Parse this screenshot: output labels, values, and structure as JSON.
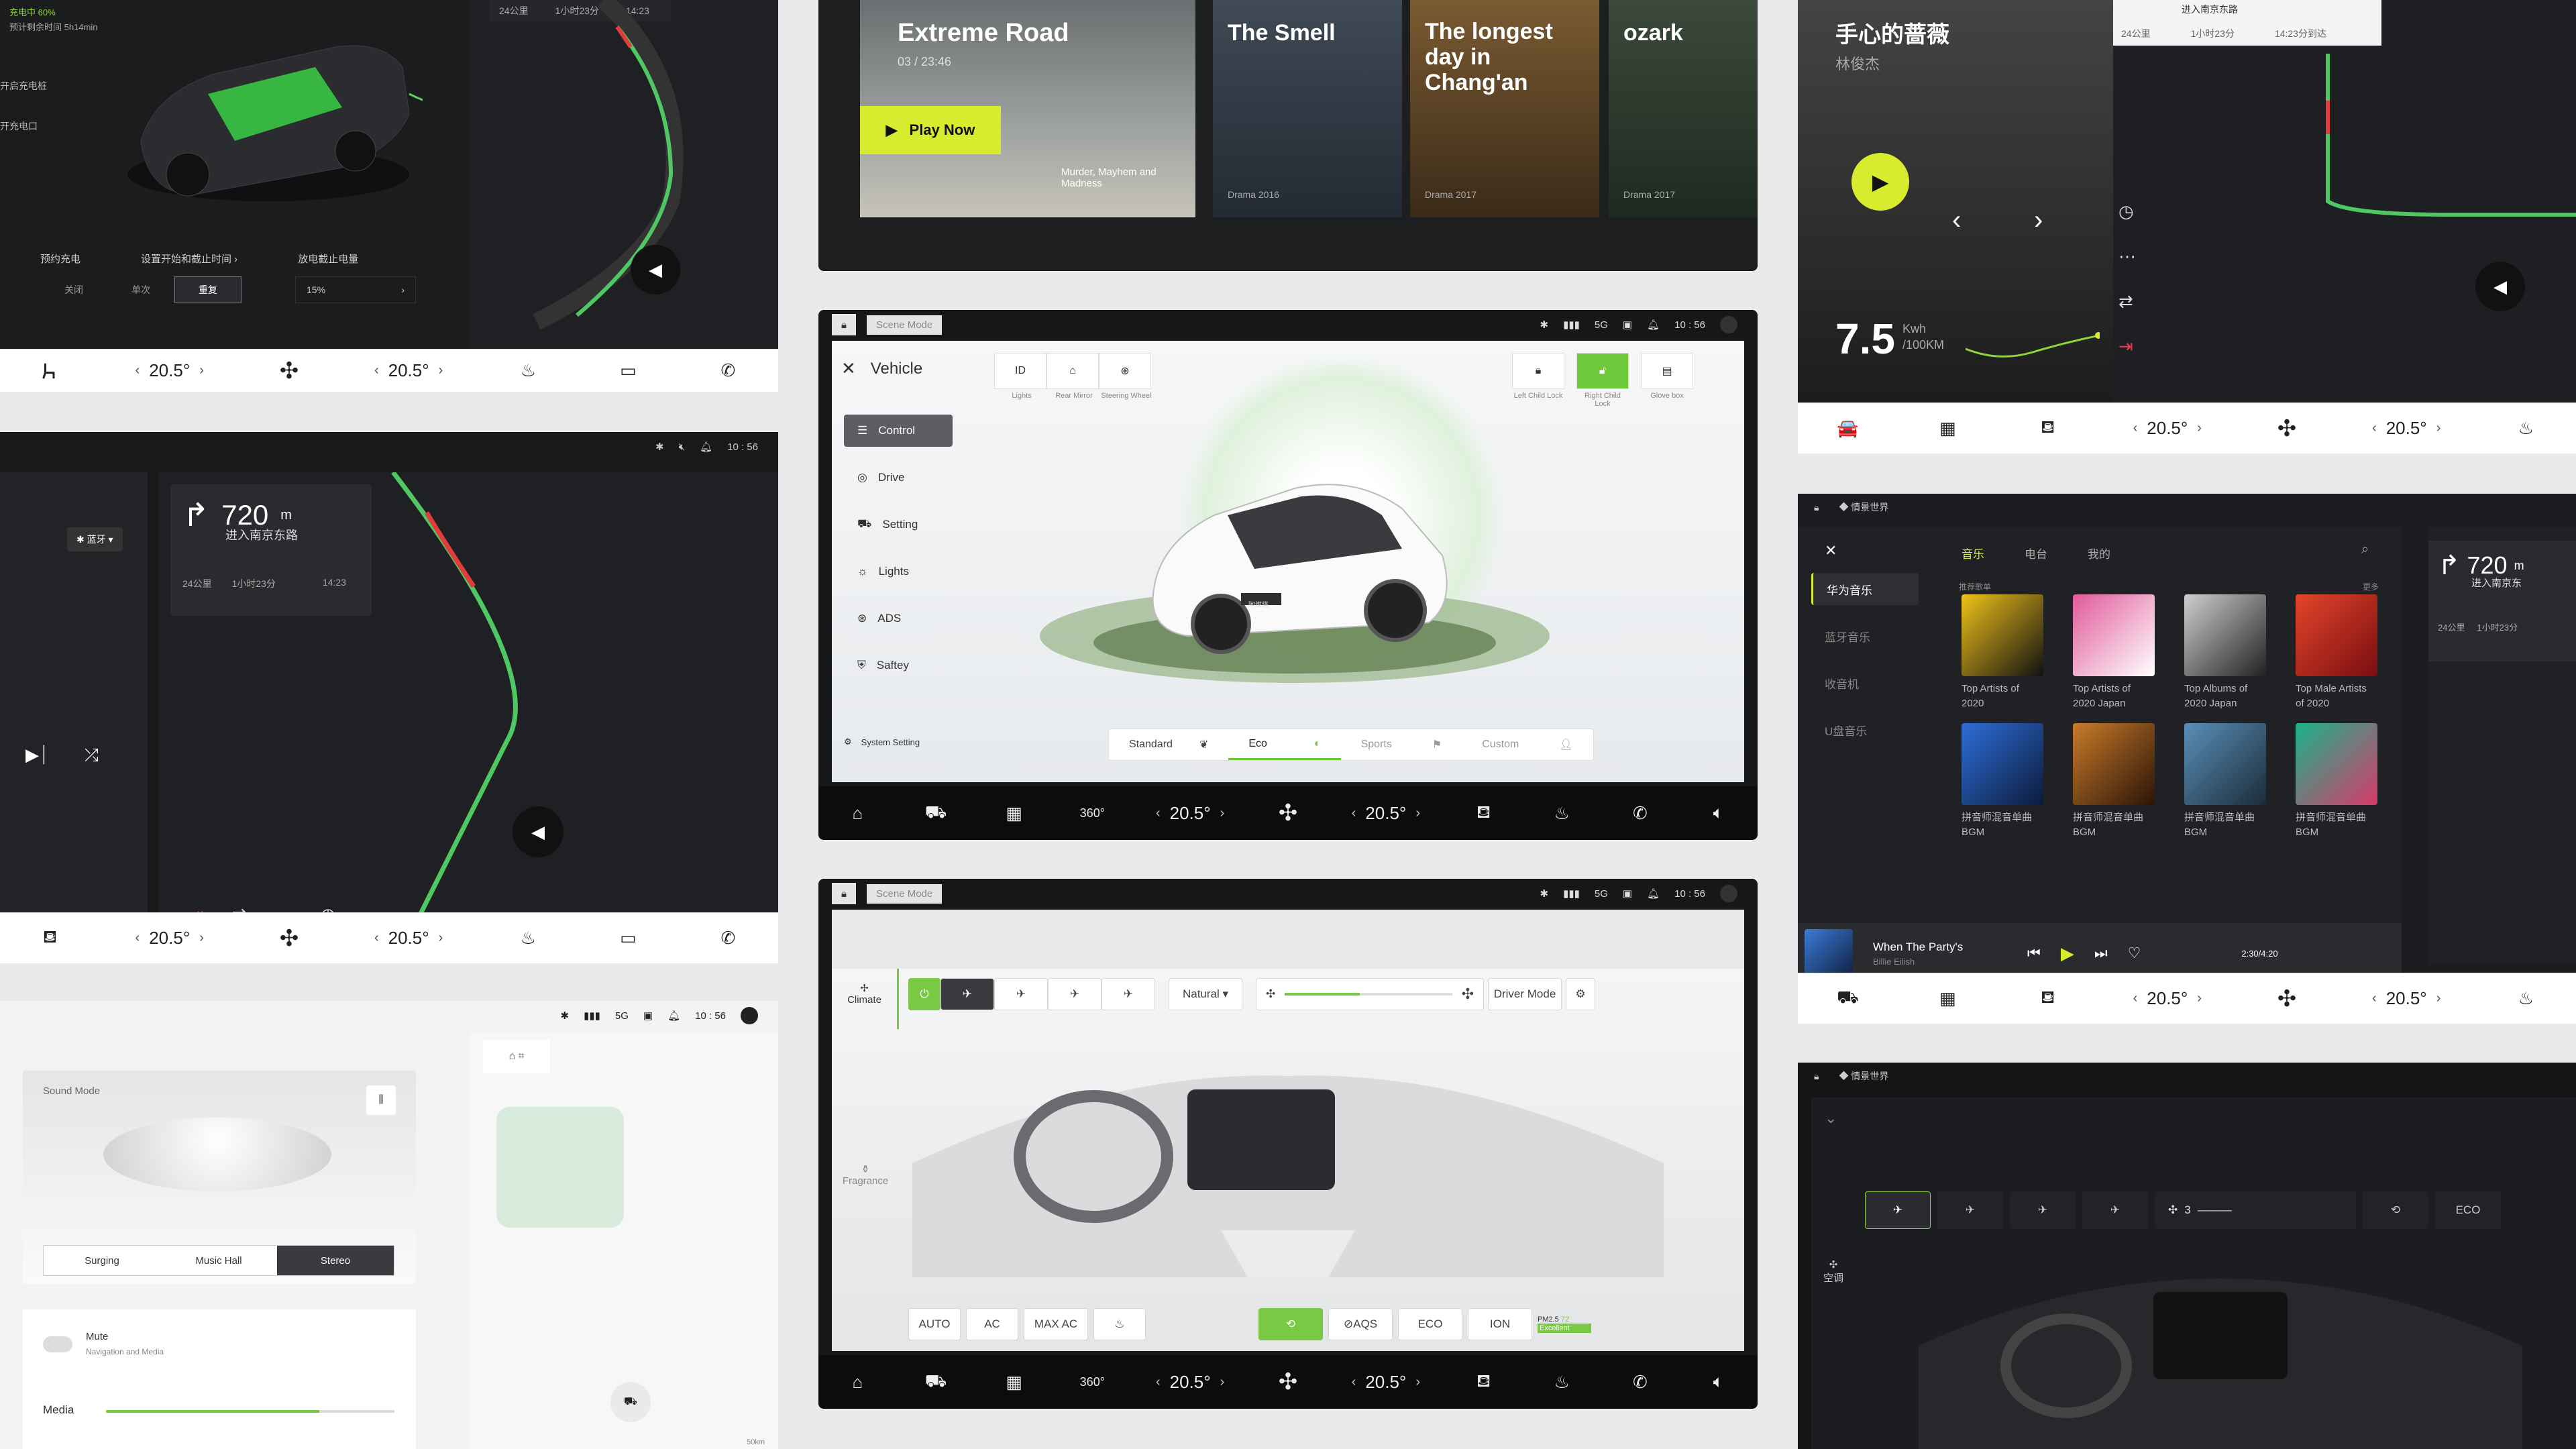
{
  "dock": {
    "temp_left": "20.5°",
    "temp_right": "20.5°",
    "chev_left": "‹",
    "chev_right": "›"
  },
  "charging": {
    "status_line1": "充电中 60%",
    "status_line2": "预计剩余时间 5h14min",
    "side_label1": "开启充电桩",
    "side_label2": "开充电口",
    "labels": [
      "预约充电",
      "设置开始和截止时间 ›",
      "放电截止电量"
    ],
    "seg": [
      "关闭",
      "单次",
      "重复"
    ],
    "battery": "15%"
  },
  "nav_top": {
    "meta": [
      "24公里",
      "1小时23分",
      "14:23"
    ]
  },
  "streaming": {
    "cards": [
      {
        "title": "Extreme Road",
        "sub": "03 / 23:46",
        "button": "Play Now",
        "extra": "Murder, Mayhem and Madness"
      },
      {
        "title": "The Smell",
        "sub": "Drama 2016"
      },
      {
        "title": "The longest day in Chang'an",
        "sub": "Drama 2017"
      },
      {
        "title": "ozark",
        "sub": "Drama 2017"
      }
    ]
  },
  "music_card": {
    "title": "手心的蔷薇",
    "artist": "林俊杰",
    "consumption": "7.5",
    "unit1": "Kwh",
    "unit2": "/100KM",
    "nav_dest": "进入南京东路",
    "nav_meta": [
      "24公里",
      "1小时23分",
      "14:23分到达"
    ]
  },
  "statusbar": {
    "time": "10 : 56",
    "net": "5G"
  },
  "vehicle": {
    "scene": "Scene Mode",
    "title": "Vehicle",
    "menu": [
      "Control",
      "Drive",
      "Setting",
      "Lights",
      "ADS",
      "Saftey"
    ],
    "system": "System Setting",
    "controls": [
      "Lights",
      "Rear Mirror",
      "Steering Wheel"
    ],
    "locks": [
      "Left Child Lock",
      "Right Child Lock",
      "Glove box"
    ],
    "modes": [
      "Standard",
      "Eco",
      "Sports",
      "Custom"
    ],
    "car_badge": "阿维塔"
  },
  "nav_mid": {
    "bt": "蓝牙 ▾",
    "distance": "720",
    "unit": "m",
    "road": "进入南京东路",
    "meta": [
      "24公里",
      "1小时23分",
      "14:23"
    ]
  },
  "music_app": {
    "brand": "情景世界",
    "tabs": [
      "音乐",
      "电台",
      "我的"
    ],
    "side": [
      "华为音乐",
      "蓝牙音乐",
      "收音机",
      "U盘音乐"
    ],
    "section": "推荐歌单",
    "more": "更多",
    "albums": [
      {
        "t": "Top Artists of 2020",
        "c1": "#f0c21a",
        "c2": "#111"
      },
      {
        "t": "Top Artists of 2020 Japan",
        "c1": "#e05a9a",
        "c2": "#ffffff"
      },
      {
        "t": "Top Albums of 2020 Japan",
        "c1": "#cfcfcf",
        "c2": "#222"
      },
      {
        "t": "Top Male Artists of 2020",
        "c1": "#e2452a",
        "c2": "#7a0d10"
      },
      {
        "t": "拼音师混音单曲 BGM",
        "c1": "#2f6fd8",
        "c2": "#0b1a3a"
      },
      {
        "t": "拼音师混音单曲 BGM",
        "c1": "#c87a2a",
        "c2": "#2a1506"
      },
      {
        "t": "拼音师混音单曲 BGM",
        "c1": "#5a8fb8",
        "c2": "#1a2c3a"
      },
      {
        "t": "拼音师混音单曲 BGM",
        "c1": "#1ab38a",
        "c2": "#d63a6a"
      }
    ],
    "song": "When The Party's",
    "artist": "Billie Eilish",
    "time": "2:30/4:20"
  },
  "nav_right": {
    "distance": "720",
    "unit": "m",
    "road": "进入南京东",
    "meta": [
      "24公里",
      "1小时23分"
    ]
  },
  "sound": {
    "title": "Sound Mode",
    "modes": [
      "Surging",
      "Music Hall",
      "Stereo"
    ],
    "mute": "Mute",
    "mute_sub": "Navigation and Media",
    "media": "Media",
    "media_level": 0.74,
    "scale": "50km"
  },
  "climate": {
    "scene": "Scene Mode",
    "side": [
      "Climate",
      "Fragrance"
    ],
    "mode": "Natural ▾",
    "driver": "Driver Mode",
    "fan_level": 0.45,
    "buttons": [
      "AUTO",
      "AC",
      "MAX AC",
      "AQS",
      "ECO",
      "ION"
    ],
    "pm_label": "PM2.5",
    "pm_value": "72",
    "pm_status": "Excellent"
  },
  "ac_dark": {
    "brand": "情景世界",
    "label": "空调",
    "fan": "3",
    "eco": "ECO"
  }
}
